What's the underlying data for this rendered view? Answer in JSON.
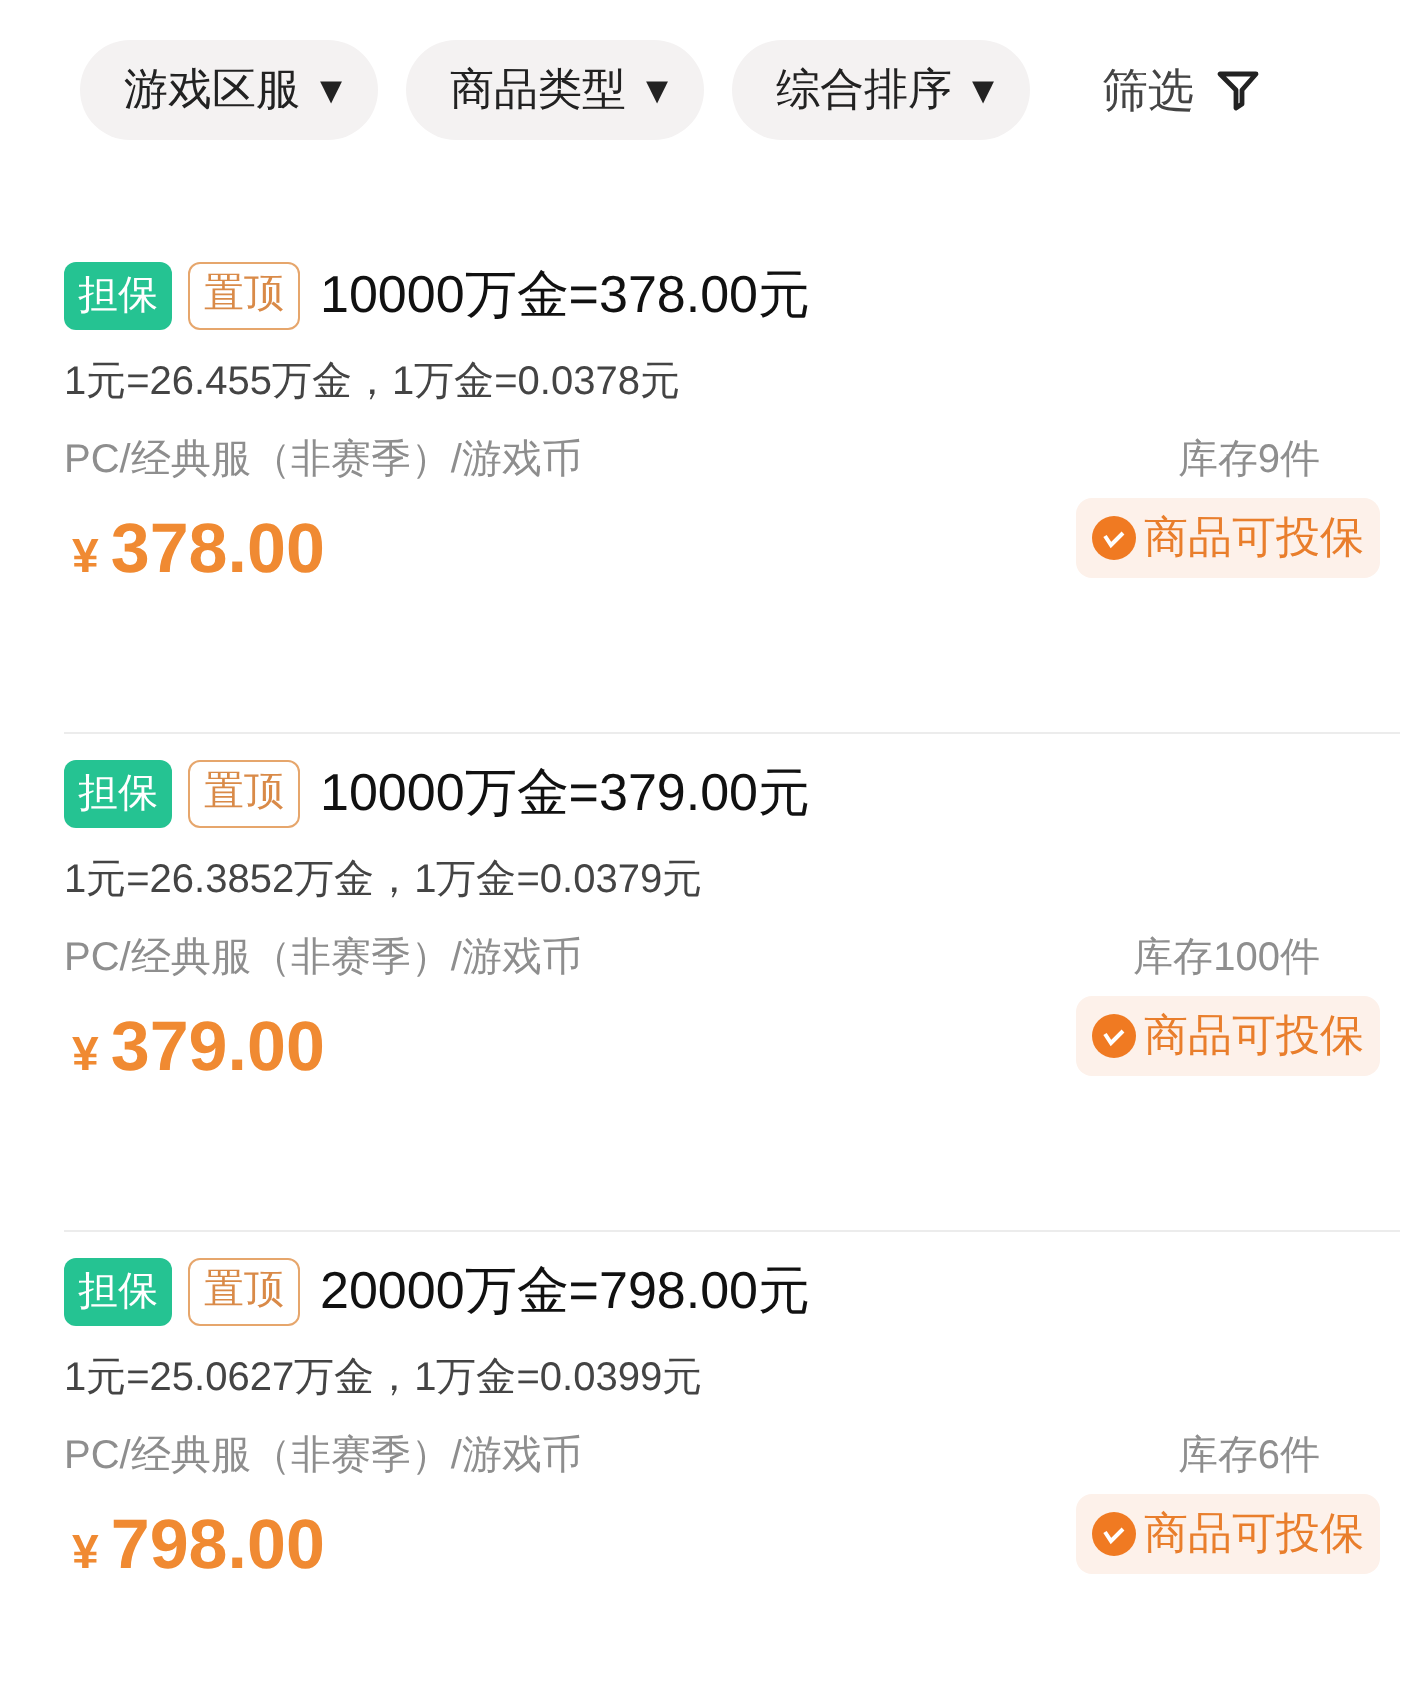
{
  "filters": [
    {
      "label": "游戏区服",
      "icon": "▾"
    },
    {
      "label": "商品类型",
      "icon": "▾"
    },
    {
      "label": "综合排序",
      "icon": "▾"
    }
  ],
  "filter_button": {
    "label": "筛选"
  },
  "listings": [
    {
      "tags": [
        {
          "label": "担保",
          "kind": "solid"
        },
        {
          "label": "置顶",
          "kind": "outline"
        }
      ],
      "title": "10000万金=378.00元",
      "rate": "1元=26.455万金，1万金=0.0378元",
      "category": "PC/经典服（非赛季）/游戏币",
      "stock": "库存9件",
      "currency": "¥",
      "price": "378.00",
      "badge": "商品可投保"
    },
    {
      "tags": [
        {
          "label": "担保",
          "kind": "solid"
        },
        {
          "label": "置顶",
          "kind": "outline"
        }
      ],
      "title": "10000万金=379.00元",
      "rate": "1元=26.3852万金，1万金=0.0379元",
      "category": "PC/经典服（非赛季）/游戏币",
      "stock": "库存100件",
      "currency": "¥",
      "price": "379.00",
      "badge": "商品可投保"
    },
    {
      "tags": [
        {
          "label": "担保",
          "kind": "solid"
        },
        {
          "label": "置顶",
          "kind": "outline"
        }
      ],
      "title": "20000万金=798.00元",
      "rate": "1元=25.0627万金，1万金=0.0399元",
      "category": "PC/经典服（非赛季）/游戏币",
      "stock": "库存6件",
      "currency": "¥",
      "price": "798.00",
      "badge": "商品可投保"
    }
  ]
}
